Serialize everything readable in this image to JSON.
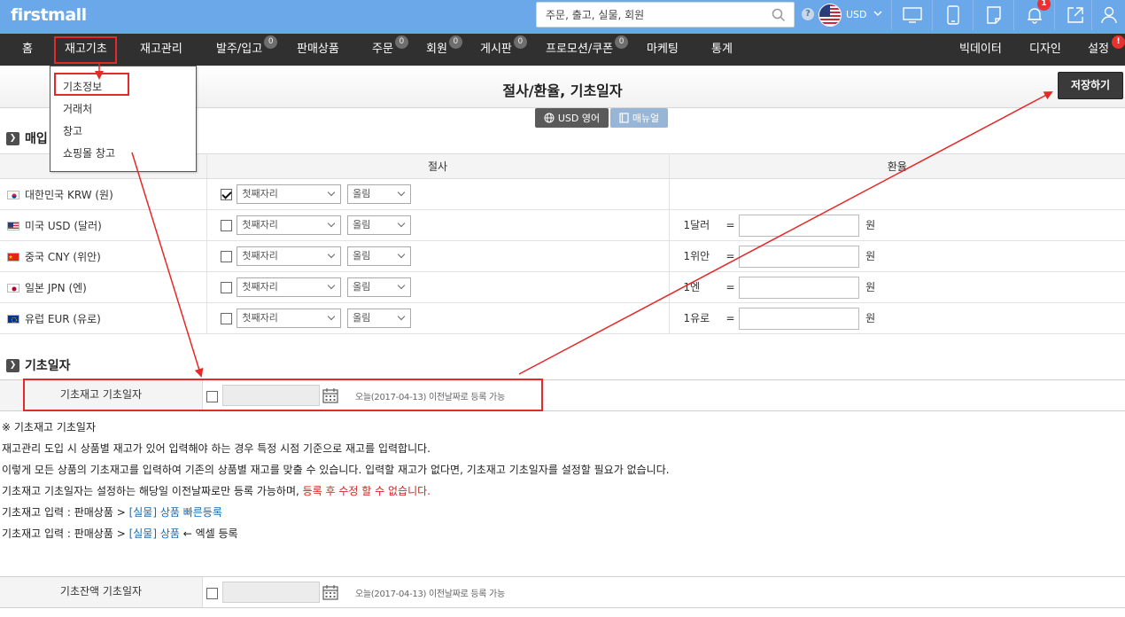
{
  "header": {
    "logo": "firstmall",
    "search_placeholder": "주문, 출고, 실물, 회원",
    "currency": "USD",
    "notification_count": "1",
    "settings_badge": "!"
  },
  "nav": {
    "items": [
      {
        "label": "홈"
      },
      {
        "label": "재고기초"
      },
      {
        "label": "재고관리"
      },
      {
        "label": "발주/입고",
        "badge": "0"
      },
      {
        "label": "판매상품"
      },
      {
        "label": "주문",
        "badge": "0"
      },
      {
        "label": "회원",
        "badge": "0"
      },
      {
        "label": "게시판",
        "badge": "0"
      },
      {
        "label": "프로모션/쿠폰",
        "badge": "0"
      },
      {
        "label": "마케팅"
      },
      {
        "label": "통계"
      },
      {
        "label": "빅데이터"
      },
      {
        "label": "디자인"
      },
      {
        "label": "설정"
      }
    ]
  },
  "dropdown": {
    "items": [
      "기초정보",
      "거래처",
      "창고",
      "쇼핑몰 창고"
    ]
  },
  "page": {
    "title": "절사/환율, 기초일자",
    "save_label": "저장하기",
    "usd_lang_label": "USD 영어",
    "manual_label": "매뉴얼"
  },
  "section_purchase": {
    "title": "매입",
    "col_cut": "절사",
    "col_rate": "환율",
    "rows": [
      {
        "country": "대한민국 KRW (원)",
        "checked": true,
        "digit": "첫째자리",
        "round": "올림",
        "unit": "",
        "eq": "",
        "won": ""
      },
      {
        "country": "미국 USD (달러)",
        "checked": false,
        "digit": "첫째자리",
        "round": "올림",
        "unit": "1달러",
        "eq": "=",
        "won": "원"
      },
      {
        "country": "중국 CNY (위안)",
        "checked": false,
        "digit": "첫째자리",
        "round": "올림",
        "unit": "1위안",
        "eq": "=",
        "won": "원"
      },
      {
        "country": "일본 JPN (엔)",
        "checked": false,
        "digit": "첫째자리",
        "round": "올림",
        "unit": "1엔",
        "eq": "=",
        "won": "원"
      },
      {
        "country": "유럽 EUR (유로)",
        "checked": false,
        "digit": "첫째자리",
        "round": "올림",
        "unit": "1유로",
        "eq": "=",
        "won": "원"
      }
    ]
  },
  "section_base": {
    "title": "기초일자",
    "stock_label": "기초재고 기초일자",
    "stock_hint": "오늘(2017-04-13) 이전날짜로 등록 가능",
    "balance_label": "기초잔액 기초일자",
    "balance_hint": "오늘(2017-04-13) 이전날짜로 등록 가능"
  },
  "notes": {
    "heading": "※ 기초재고 기초일자",
    "line1": "재고관리 도입 시 상품별 재고가 있어 입력해야 하는 경우 특정 시점 기준으로 재고를 입력합니다.",
    "line2": "이렇게 모든 상품의 기초재고를 입력하여 기존의 상품별 재고를 맞출 수 있습니다. 입력할 재고가 없다면, 기초재고 기초일자를 설정할 필요가 없습니다.",
    "line3_a": "기초재고 기초일자는 설정하는 해당일 이전날짜로만 등록 가능하며, ",
    "line3_red": "등록 후 수정 할 수 없습니다.",
    "line4_a": "기초재고 입력 : 판매상품 > ",
    "line4_link": "[실물] 상품 빠른등록",
    "line5_a": "기초재고 입력 : 판매상품 > ",
    "line5_link": "[실물] 상품",
    "line5_b": " ← 엑셀 등록"
  },
  "colors": {
    "topbar": "#6aa8ea",
    "navbar": "#303030",
    "highlight": "#e52828",
    "link": "#1b6bb0"
  }
}
